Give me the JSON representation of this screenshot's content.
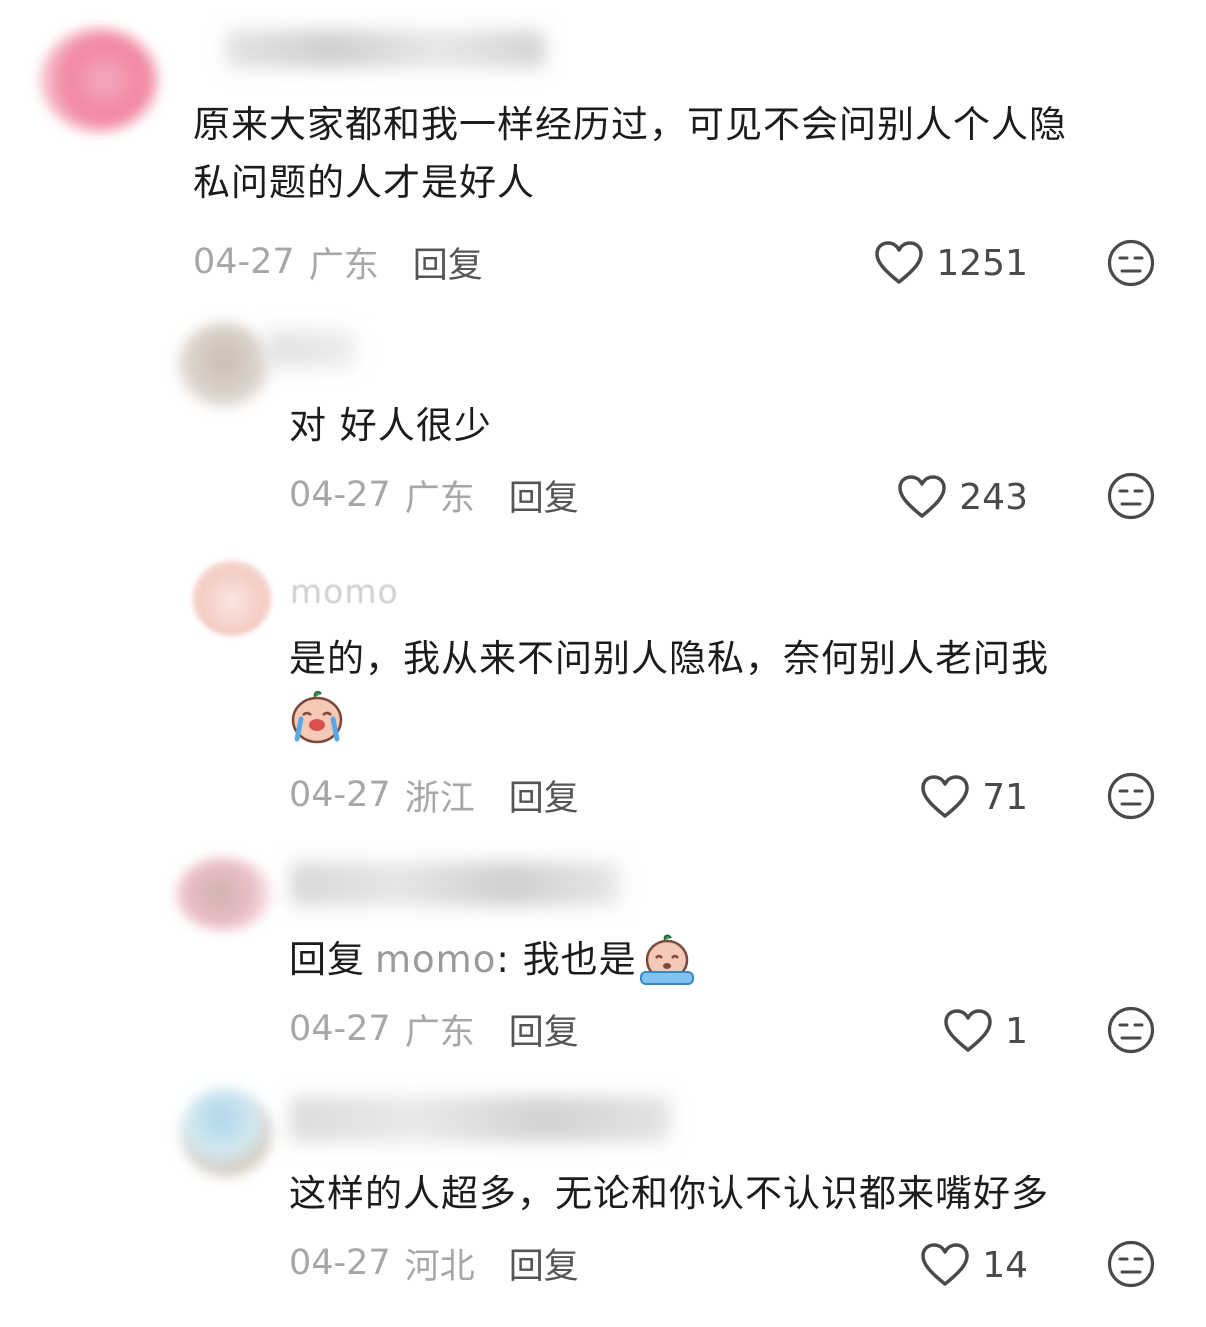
{
  "comments": [
    {
      "body": "原来大家都和我一样经历过，可见不会问别人个人隐私问题的人才是好人",
      "body_line1": "原来大家都和我一样经历过，可见不会问别人个人隐",
      "body_line2": "私问题的人才是好人",
      "date": "04-27",
      "region": "广东",
      "reply_label": "回复",
      "likes": "1251"
    },
    {
      "body": "对 好人很少",
      "date": "04-27",
      "region": "广东",
      "reply_label": "回复",
      "likes": "243"
    },
    {
      "username": "momo",
      "body_line1": "是的，我从来不问别人隐私，奈何别人老问我",
      "emoji": "crying-emoji",
      "date": "04-27",
      "region": "浙江",
      "reply_label": "回复",
      "likes": "71"
    },
    {
      "reply_prefix": "回复",
      "mention": "momo",
      "body_text": ": 我也是",
      "emoji": "crying-emoji",
      "date": "04-27",
      "region": "广东",
      "reply_label": "回复",
      "likes": "1"
    },
    {
      "body": "这样的人超多，无论和你认不认识都来嘴好多",
      "date": "04-27",
      "region": "河北",
      "reply_label": "回复",
      "likes": "14"
    }
  ],
  "icons": {
    "like": "heart-icon",
    "dislike": "unamused-face-icon"
  },
  "colors": {
    "text": "#1c1c1c",
    "meta": "#a7a7a7",
    "reply": "#555555",
    "icon": "#4a4a4a"
  }
}
